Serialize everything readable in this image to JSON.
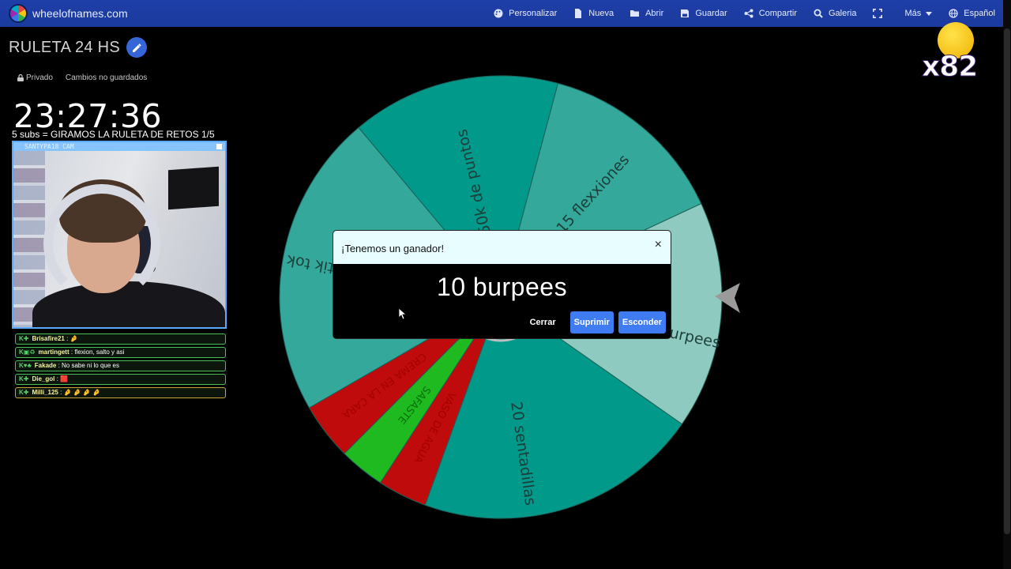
{
  "navbar": {
    "brand": "wheelofnames.com",
    "items": [
      {
        "label": "Personalizar",
        "icon": "palette-icon"
      },
      {
        "label": "Nueva",
        "icon": "file-icon"
      },
      {
        "label": "Abrir",
        "icon": "folder-open-icon"
      },
      {
        "label": "Guardar",
        "icon": "save-icon"
      },
      {
        "label": "Compartir",
        "icon": "share-icon"
      },
      {
        "label": "Galeria",
        "icon": "search-icon"
      },
      {
        "label": "",
        "icon": "fullscreen-icon"
      },
      {
        "label": "Más",
        "icon": "chevron-down-icon"
      },
      {
        "label": "Español",
        "icon": "globe-icon"
      }
    ]
  },
  "wheel_page": {
    "title": "RULETA 24 HS",
    "privacy": "Privado",
    "save_status": "Cambios no guardados"
  },
  "stream": {
    "timer": "23:27:36",
    "subs_goal": "5 subs = GIRAMOS LA RULETA DE RETOS 1/5",
    "cam_label": "SANTYPA18 CAM",
    "emote_count": "x82",
    "chat": [
      {
        "user": "Brisafire21",
        "message": "🤌"
      },
      {
        "user": "martingett",
        "message": "flexion, salto y asi"
      },
      {
        "user": "Fakade",
        "message": "No sabe ni lo que es"
      },
      {
        "user": "Die_gol",
        "message": "🟥"
      },
      {
        "user": "Milli_125",
        "message": "🤌 🤌 🤌 🤌"
      }
    ]
  },
  "wheel": {
    "segments": [
      {
        "label": "50k de puntos",
        "color": "#00998a"
      },
      {
        "label": "15 flexxiones",
        "color": "#33a89b"
      },
      {
        "label": "10 burpees",
        "color": "#8fcac1"
      },
      {
        "label": "20 sentadillas",
        "color": "#00998a"
      },
      {
        "label": "VASO DE AGUA",
        "color": "#bf0b0b"
      },
      {
        "label": "SAFASTE",
        "color": "#1fba1f"
      },
      {
        "label": "CREMA EN LA CARA",
        "color": "#bf0b0b"
      },
      {
        "label": "tik tok",
        "color": "#33a89b"
      }
    ]
  },
  "dialog": {
    "title": "¡Tenemos un ganador!",
    "winner": "10 burpees",
    "close_label": "Cerrar",
    "remove_label": "Suprimir",
    "hide_label": "Esconder"
  }
}
